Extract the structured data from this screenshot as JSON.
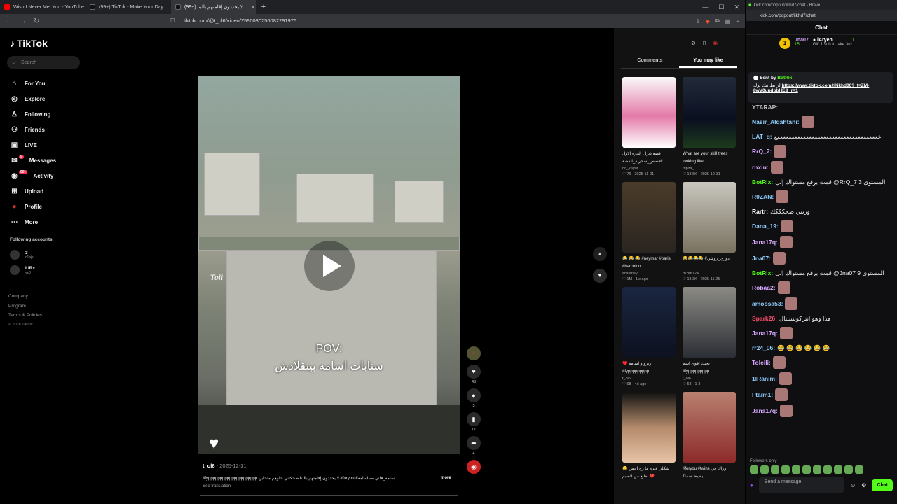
{
  "browser": {
    "tabs": [
      {
        "title": "Wish I Never Met You - YouTube",
        "color": "#ff0000"
      },
      {
        "title": "(99+) TikTok - Make Your Day",
        "color": "#111"
      },
      {
        "title": "(99+) لا يحددون إقامتهم بالبنا...",
        "color": "#111"
      }
    ],
    "url": "tiktok.com/@t_ol6/video/7590030256082291976"
  },
  "tiktok": {
    "logo": "TikTok",
    "search_placeholder": "Search",
    "menu": [
      {
        "label": "For You",
        "icon": "home-icon"
      },
      {
        "label": "Explore",
        "icon": "compass-icon"
      },
      {
        "label": "Following",
        "icon": "following-icon"
      },
      {
        "label": "Friends",
        "icon": "friends-icon"
      },
      {
        "label": "LIVE",
        "icon": "live-icon"
      },
      {
        "label": "Messages",
        "icon": "messages-icon",
        "badge": "9"
      },
      {
        "label": "Activity",
        "icon": "activity-icon",
        "badge": "99+"
      },
      {
        "label": "Upload",
        "icon": "upload-icon"
      },
      {
        "label": "Profile",
        "icon": "profile-icon"
      },
      {
        "label": "More",
        "icon": "more-icon"
      }
    ],
    "following_title": "Following accounts",
    "following": [
      {
        "name": "3",
        "sub": "c1ajs"
      },
      {
        "name": "LiRx",
        "sub": "yx8"
      }
    ],
    "footer": {
      "company": "Company",
      "program": "Program",
      "terms": "Terms & Policies",
      "copyright": "© 2026 TikTok"
    },
    "video": {
      "overlay_arabic": "POV:",
      "overlay_line2": "سنابات اسامه بينقلادش",
      "watermark": "Toli",
      "author": "t_ol6",
      "date": "2025-12-31",
      "description": "#fyppppppppppppppppppppp لا يحددون إقامتهم بالبنا ضحكتني خلوهم متخلين #foryou #اسامه_فاني — اسامه",
      "more": "more",
      "see_translation": "See translation",
      "likes": "43",
      "comments": "3",
      "saves": "17",
      "shares": "4"
    },
    "tabs": {
      "comments": "Comments",
      "you_may_like": "You may like"
    },
    "cards": [
      {
        "title": "قصة ذيرا . الجزء الاول #قصص_سحريه_القصة",
        "user": "ho_kayat",
        "likes": "76",
        "date": "2025-11-21",
        "bg": "linear-gradient(#fafafa,#e47aa8 55%,#fff)"
      },
      {
        "title": "What are your skill trees looking like...",
        "user": "tripza_",
        "likes": "13.8K",
        "date": "2025-12-31",
        "bg": "linear-gradient(#222b3a,#0a0f20 60%,#1c3a1c)"
      },
      {
        "title": "😂 😂 😂 #neymar #paris #barcelon...",
        "user": "soslaney",
        "likes": "1M",
        "date": "1w ago",
        "bg": "linear-gradient(#4a3b2a,#2a2520)"
      },
      {
        "title": "😂😂😂😂 #دوري_روشن",
        "user": "d7om724",
        "likes": "13.3K",
        "date": "2025-11-25",
        "bg": "linear-gradient(#c8c6be,#7a7260)"
      },
      {
        "title": "♥️ زيزو و اسامه #fyppppppppp...",
        "user": "t_ol6",
        "likes": "98",
        "date": "4d ago",
        "bg": "linear-gradient(#1a2640,#0d1120)"
      },
      {
        "title": "يحيك اقوى اسم #fyppppppppp...",
        "user": "t_ol6",
        "likes": "58",
        "date": "1-3",
        "bg": "linear-gradient(#8b8a84,#2b2e34)"
      },
      {
        "title": "شكلي فترة ما رح احس 😢 ❤️ اطلع من الصيم",
        "user": "",
        "likes": "",
        "date": "",
        "bg": "linear-gradient(#111,#b38a6a 50%,#e8c4a8)"
      },
      {
        "title": "#foryou #twins وراك في يطيط سما؟",
        "user": "",
        "likes": "",
        "date": "",
        "bg": "linear-gradient(#b98070,#8c2a2a)"
      }
    ]
  },
  "kick": {
    "tab_title": "kick.com/popout/iikhd7/chat - Brave",
    "address": "kick.com/popout/iikhd7/chat",
    "header": "Chat",
    "leader1": {
      "name": "Jna07",
      "count": "15"
    },
    "leader2": {
      "name": "iAryen",
      "count": "1"
    },
    "gift_text": "Gift 1 sub to take 3rd",
    "pinned_by": "Sent by",
    "pinned_user": "BotRix",
    "pinned_text": "لرابط تيك توك",
    "pinned_link": "https://www.tiktok.com/@ikhd00?_t=ZM-8wV0updpbHE&_r=1",
    "messages": [
      {
        "user": "YTARAP:",
        "color": "#bbbbbb",
        "text": "..."
      },
      {
        "user": "Nasir_Alqahtani:",
        "color": "#8ecbfa",
        "text": ""
      },
      {
        "user": "LAT_q:",
        "color": "#8ecbfa",
        "text": "ععععععععععععععععععععععععععععععععععععع"
      },
      {
        "user": "RrQ_7:",
        "color": "#d8a8ff",
        "text": ""
      },
      {
        "user": "rnxiu:",
        "color": "#d8a8ff",
        "text": ""
      },
      {
        "user": "BotRix:",
        "color": "#53fc18",
        "text": "قمت برفع مستواك إلى @RrQ_7 المستوى 3"
      },
      {
        "user": "R0ZAN:",
        "color": "#8ecbfa",
        "text": ""
      },
      {
        "user": "Rartr:",
        "color": "#ffffff",
        "text": "وريبي ضحكككك"
      },
      {
        "user": "Dana_19:",
        "color": "#8ecbfa",
        "text": ""
      },
      {
        "user": "Jana17q:",
        "color": "#d8a8ff",
        "text": ""
      },
      {
        "user": "Jna07:",
        "color": "#8ecbfa",
        "text": ""
      },
      {
        "user": "BotRix:",
        "color": "#53fc18",
        "text": "قمت برفع مستواك إلى @Jna07 المستوى 9"
      },
      {
        "user": "Robaa2:",
        "color": "#d8a8ff",
        "text": ""
      },
      {
        "user": "amoosa53:",
        "color": "#8ecbfa",
        "text": ""
      },
      {
        "user": "Spark26:",
        "color": "#ff4d6d",
        "text": "هذا وهو انتركونتيننتال"
      },
      {
        "user": "Jana17q:",
        "color": "#d8a8ff",
        "text": ""
      },
      {
        "user": "rr24_06:",
        "color": "#8ecbfa",
        "text": "😂 😂 😂 😂 😂 😂"
      },
      {
        "user": "Toleili:",
        "color": "#d8a8ff",
        "text": ""
      },
      {
        "user": "1lRanim:",
        "color": "#8ecbfa",
        "text": ""
      },
      {
        "user": "Ftaim1:",
        "color": "#8ecbfa",
        "text": ""
      },
      {
        "user": "Jana17q:",
        "color": "#d8a8ff",
        "text": ""
      }
    ],
    "followers_only": "Followers only",
    "send_placeholder": "Send a message",
    "chat_button": "Chat"
  }
}
